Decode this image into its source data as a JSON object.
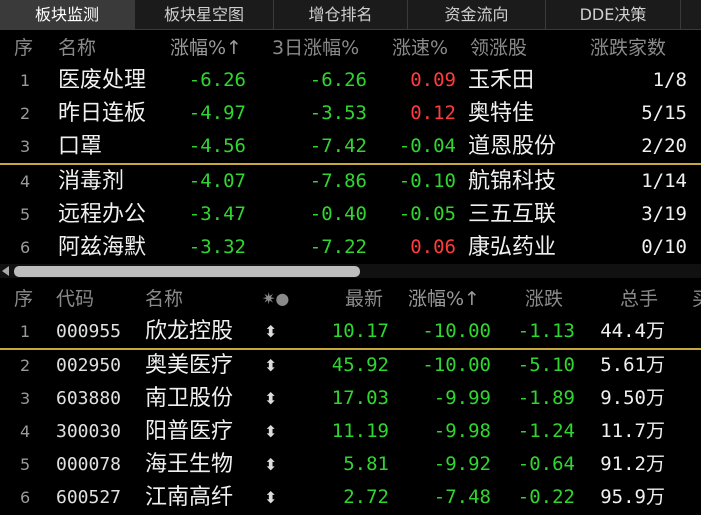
{
  "tabs": [
    {
      "label": "板块监测"
    },
    {
      "label": "板块星空图"
    },
    {
      "label": "增仓排名"
    },
    {
      "label": "资金流向"
    },
    {
      "label": "DDE决策"
    }
  ],
  "sector_table": {
    "headers": {
      "idx": "序",
      "name": "名称",
      "change": "涨幅%↑",
      "change3d": "3日涨幅%",
      "speed": "涨速%",
      "leader": "领涨股",
      "ratio": "涨跌家数"
    },
    "rows": [
      {
        "idx": "1",
        "name": "医废处理",
        "change": "-6.26",
        "change3d": "-6.26",
        "speed": "0.09",
        "leader": "玉禾田",
        "ratio": "1/8"
      },
      {
        "idx": "2",
        "name": "昨日连板",
        "change": "-4.97",
        "change3d": "-3.53",
        "speed": "0.12",
        "leader": "奥特佳",
        "ratio": "5/15"
      },
      {
        "idx": "3",
        "name": "口罩",
        "change": "-4.56",
        "change3d": "-7.42",
        "speed": "-0.04",
        "leader": "道恩股份",
        "ratio": "2/20"
      },
      {
        "idx": "4",
        "name": "消毒剂",
        "change": "-4.07",
        "change3d": "-7.86",
        "speed": "-0.10",
        "leader": "航锦科技",
        "ratio": "1/14"
      },
      {
        "idx": "5",
        "name": "远程办公",
        "change": "-3.47",
        "change3d": "-0.40",
        "speed": "-0.05",
        "leader": "三五互联",
        "ratio": "3/19"
      },
      {
        "idx": "6",
        "name": "阿兹海默",
        "change": "-3.32",
        "change3d": "-7.22",
        "speed": "0.06",
        "leader": "康弘药业",
        "ratio": "0/10"
      }
    ]
  },
  "stock_table": {
    "headers": {
      "idx": "序",
      "code": "代码",
      "name": "名称",
      "flags": "✷●",
      "price": "最新",
      "change": "涨幅%↑",
      "delta": "涨跌",
      "volume": "总手",
      "more": "买"
    },
    "rows": [
      {
        "idx": "1",
        "code": "000955",
        "name": "欣龙控股",
        "flag": "⬍",
        "price": "10.17",
        "change": "-10.00",
        "delta": "-1.13",
        "volume": "44.4万"
      },
      {
        "idx": "2",
        "code": "002950",
        "name": "奥美医疗",
        "flag": "⬍",
        "price": "45.92",
        "change": "-10.00",
        "delta": "-5.10",
        "volume": "5.61万"
      },
      {
        "idx": "3",
        "code": "603880",
        "name": "南卫股份",
        "flag": "⬍",
        "price": "17.03",
        "change": "-9.99",
        "delta": "-1.89",
        "volume": "9.50万"
      },
      {
        "idx": "4",
        "code": "300030",
        "name": "阳普医疗",
        "flag": "⬍",
        "price": "11.19",
        "change": "-9.98",
        "delta": "-1.24",
        "volume": "11.7万"
      },
      {
        "idx": "5",
        "code": "000078",
        "name": "海王生物",
        "flag": "⬍",
        "price": "5.81",
        "change": "-9.92",
        "delta": "-0.64",
        "volume": "91.2万"
      },
      {
        "idx": "6",
        "code": "600527",
        "name": "江南高纤",
        "flag": "⬍",
        "price": "2.72",
        "change": "-7.48",
        "delta": "-0.22",
        "volume": "95.9万"
      }
    ]
  },
  "colors": {
    "up": "#ff3b3b",
    "down": "#30d630",
    "highlight_line": "#c8a83a",
    "background": "#000000"
  }
}
